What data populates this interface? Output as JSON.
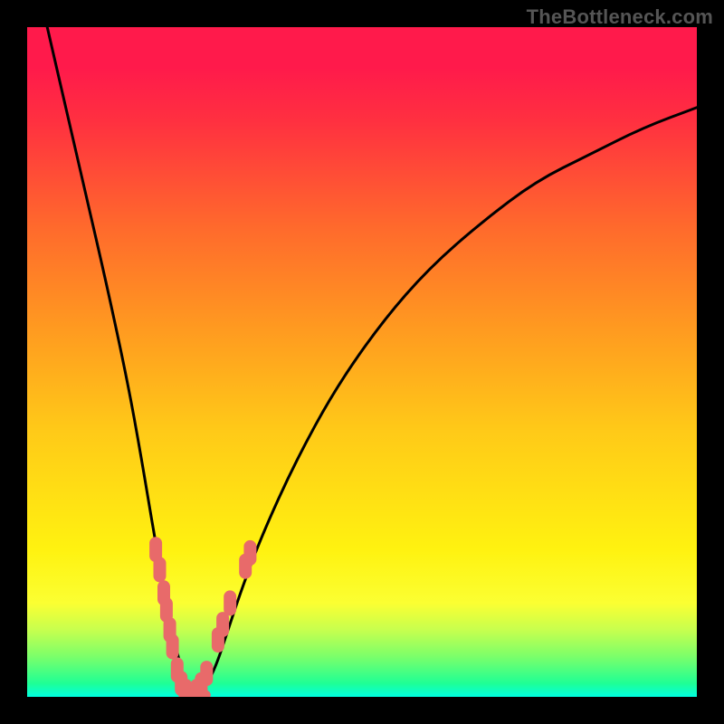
{
  "watermark": "TheBottleneck.com",
  "colors": {
    "frame_bg": "#000000",
    "curve_stroke": "#000000",
    "marker_fill": "#e86a6a",
    "gradient_top": "#ff1a4b",
    "gradient_bottom": "#00ffe0"
  },
  "chart_data": {
    "type": "line",
    "title": "",
    "xlabel": "",
    "ylabel": "",
    "xlim": [
      0,
      100
    ],
    "ylim": [
      0,
      100
    ],
    "grid": false,
    "legend": false,
    "curve": {
      "description": "V-shaped bottleneck curve; minimum ≈ x=24, y≈0",
      "points_xy_percent": [
        [
          3,
          100
        ],
        [
          6,
          87
        ],
        [
          9,
          74
        ],
        [
          12,
          61
        ],
        [
          15,
          47
        ],
        [
          17,
          36
        ],
        [
          19,
          24
        ],
        [
          21,
          13
        ],
        [
          23,
          4
        ],
        [
          24,
          0.5
        ],
        [
          25,
          0.2
        ],
        [
          26,
          0.5
        ],
        [
          28,
          4
        ],
        [
          30,
          10
        ],
        [
          32,
          16
        ],
        [
          35,
          24
        ],
        [
          40,
          35
        ],
        [
          46,
          46
        ],
        [
          53,
          56
        ],
        [
          60,
          64
        ],
        [
          68,
          71
        ],
        [
          76,
          77
        ],
        [
          84,
          81
        ],
        [
          92,
          85
        ],
        [
          100,
          88
        ]
      ]
    },
    "markers_left_xy_percent": [
      [
        19.2,
        22.0
      ],
      [
        19.8,
        19.0
      ],
      [
        20.4,
        15.5
      ],
      [
        20.8,
        13.0
      ],
      [
        21.3,
        10.0
      ],
      [
        21.7,
        7.5
      ],
      [
        22.4,
        4.0
      ],
      [
        23.0,
        2.0
      ],
      [
        23.7,
        0.8
      ]
    ],
    "markers_right_xy_percent": [
      [
        25.3,
        0.8
      ],
      [
        26.0,
        1.8
      ],
      [
        26.8,
        3.5
      ],
      [
        28.5,
        8.5
      ],
      [
        29.2,
        10.8
      ],
      [
        30.3,
        14.0
      ],
      [
        32.6,
        19.5
      ],
      [
        33.3,
        21.5
      ]
    ],
    "bottom_markers_xy_percent": [
      [
        24.2,
        0.3
      ],
      [
        25.0,
        0.3
      ],
      [
        25.8,
        0.3
      ]
    ]
  }
}
